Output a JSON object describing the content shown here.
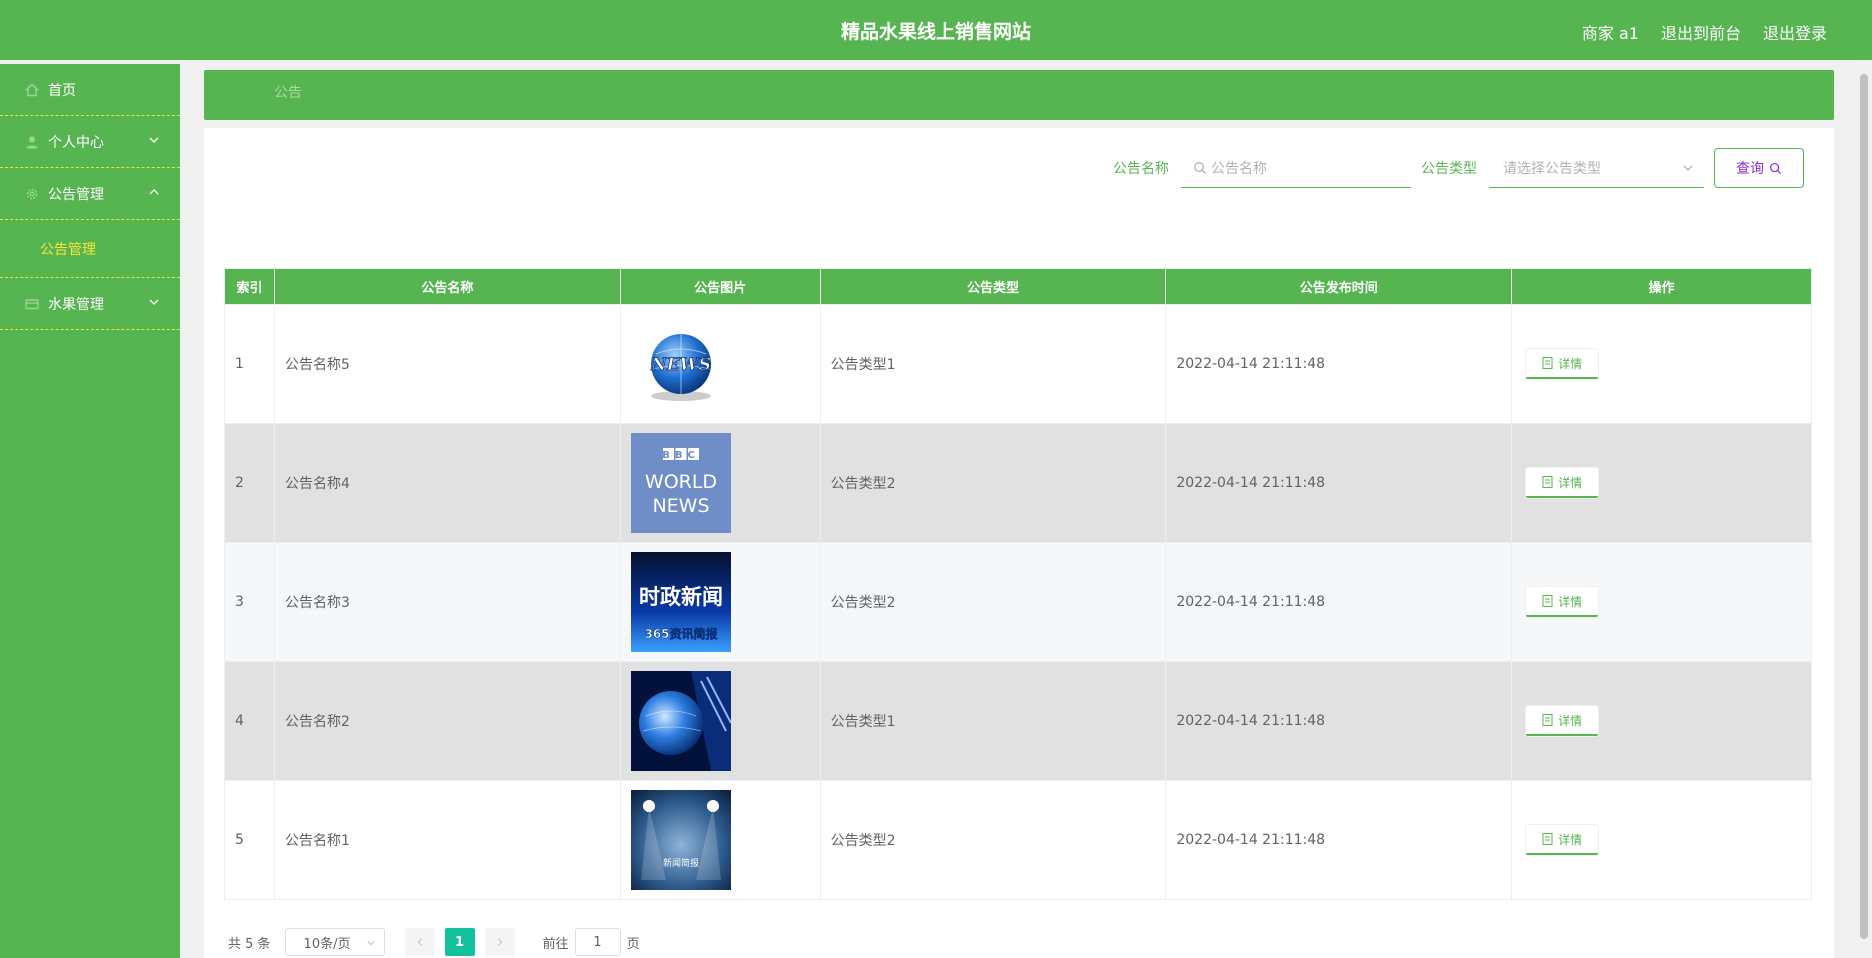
{
  "header": {
    "title": "精品水果线上销售网站",
    "user": "商家 a1",
    "to_front": "退出到前台",
    "logout": "退出登录"
  },
  "sidebar": {
    "items": [
      {
        "label": "首页",
        "icon": "home-icon"
      },
      {
        "label": "个人中心",
        "icon": "user-icon",
        "expanded": false
      },
      {
        "label": "公告管理",
        "icon": "gear-icon",
        "expanded": true
      },
      {
        "label": "公告管理",
        "sub": true
      },
      {
        "label": "水果管理",
        "icon": "card-icon",
        "expanded": false
      }
    ]
  },
  "breadcrumb": "公告",
  "search": {
    "name_label": "公告名称",
    "name_placeholder": "公告名称",
    "type_label": "公告类型",
    "type_placeholder": "请选择公告类型",
    "button": "查询"
  },
  "table": {
    "headers": [
      "索引",
      "公告名称",
      "公告图片",
      "公告类型",
      "公告发布时间",
      "操作"
    ],
    "rows": [
      {
        "index": "1",
        "name": "公告名称5",
        "image": "news-globe",
        "type": "公告类型1",
        "time": "2022-04-14 21:11:48",
        "action": "详情"
      },
      {
        "index": "2",
        "name": "公告名称4",
        "image": "bbc-world-news",
        "type": "公告类型2",
        "time": "2022-04-14 21:11:48",
        "action": "详情"
      },
      {
        "index": "3",
        "name": "公告名称3",
        "image": "shizheng-news",
        "type": "公告类型2",
        "time": "2022-04-14 21:11:48",
        "action": "详情"
      },
      {
        "index": "4",
        "name": "公告名称2",
        "image": "blue-globe",
        "type": "公告类型1",
        "time": "2022-04-14 21:11:48",
        "action": "详情"
      },
      {
        "index": "5",
        "name": "公告名称1",
        "image": "news-stage",
        "type": "公告类型2",
        "time": "2022-04-14 21:11:48",
        "action": "详情"
      }
    ],
    "image_text": {
      "bbc_line1": "BBC",
      "bbc_line2": "WORLD",
      "bbc_line3": "NEWS",
      "sz_line1": "时政新闻",
      "sz_line2": "365资讯简报",
      "stage_text": "新闻简报"
    }
  },
  "pagination": {
    "total": "共 5 条",
    "page_size": "10条/页",
    "current": "1",
    "goto_label": "前往",
    "goto_value": "1",
    "page_unit": "页"
  },
  "colors": {
    "primary": "#57b551",
    "active_sub": "#f5e53a",
    "page_active": "#13c29c"
  }
}
